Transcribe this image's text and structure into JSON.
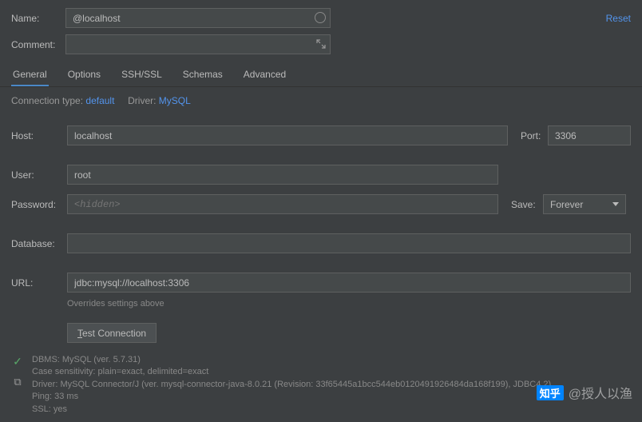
{
  "header": {
    "name_label": "Name:",
    "name_value": "@localhost",
    "comment_label": "Comment:",
    "comment_value": "",
    "reset": "Reset"
  },
  "tabs": [
    "General",
    "Options",
    "SSH/SSL",
    "Schemas",
    "Advanced"
  ],
  "conn": {
    "type_label": "Connection type:",
    "type_value": "default",
    "driver_label": "Driver:",
    "driver_value": "MySQL"
  },
  "fields": {
    "host_label": "Host:",
    "host_value": "localhost",
    "port_label": "Port:",
    "port_value": "3306",
    "user_label": "User:",
    "user_value": "root",
    "password_label": "Password:",
    "password_placeholder": "<hidden>",
    "save_label": "Save:",
    "save_value": "Forever",
    "database_label": "Database:",
    "database_value": "",
    "url_label": "URL:",
    "url_value": "jdbc:mysql://localhost:3306",
    "url_hint": "Overrides settings above"
  },
  "test_btn_prefix": "T",
  "test_btn_rest": "est Connection",
  "status": {
    "dbms": "DBMS: MySQL (ver. 5.7.31)",
    "case": "Case sensitivity: plain=exact, delimited=exact",
    "driver": "Driver: MySQL Connector/J (ver. mysql-connector-java-8.0.21 (Revision: 33f65445a1bcc544eb0120491926484da168f199), JDBC4.2)",
    "ping": "Ping: 33 ms",
    "ssl": "SSL: yes"
  },
  "watermark": {
    "logo": "知乎",
    "text": "@授人以渔"
  }
}
